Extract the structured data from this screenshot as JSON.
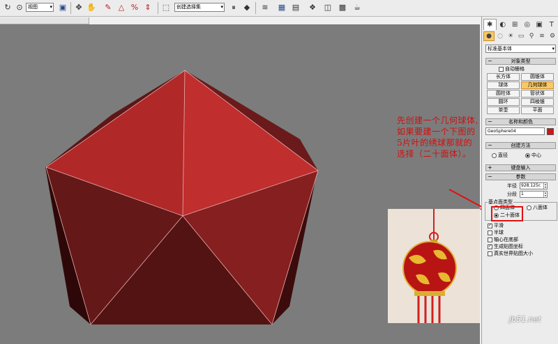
{
  "toolbar": {
    "view_select": "视图",
    "selection_set": "创建选择集"
  },
  "annotation": {
    "text": "先创建一个几何球体,如果要建一个下图的5片叶的绣球那就的选择（二十面体）。"
  },
  "command_panel": {
    "category_dropdown": "标准基本体",
    "object_type": {
      "header": "对象类型",
      "autogrid_label": "自动栅格",
      "buttons": [
        "长方体",
        "圆锥体",
        "球体",
        "几何球体",
        "圆柱体",
        "管状体",
        "圆环",
        "四棱锥",
        "茶壶",
        "平面"
      ],
      "active": "几何球体"
    },
    "name_color": {
      "header": "名称和颜色",
      "name_value": "GeoSphere04",
      "color": "#c81818"
    },
    "creation_method": {
      "header": "创建方法",
      "options": [
        "直径",
        "中心"
      ],
      "selected": "中心"
    },
    "keyboard_entry": {
      "header": "键盘输入"
    },
    "parameters": {
      "header": "参数",
      "radius_label": "半径",
      "radius_value": "928.125c",
      "segments_label": "分段",
      "segments_value": "1",
      "base_type_title": "基点面类型",
      "base_types": [
        "四面体",
        "八面体",
        "二十面体"
      ],
      "base_selected": "二十面体",
      "smooth_label": "平滑",
      "hemisphere_label": "半球",
      "base_pivot_label": "轴心在底部",
      "gen_mapping_label": "生成贴图坐标",
      "real_world_label": "真实世界贴图大小",
      "smooth_checked": true,
      "hemisphere_checked": false,
      "base_pivot_checked": false,
      "gen_mapping_checked": true,
      "real_world_checked": false
    }
  },
  "watermark": "jb51.net",
  "colors": {
    "viewport_bg": "#7c7c7c",
    "face_light": "#b42828",
    "face_dark": "#5a1414",
    "annotation_red": "#d01010"
  }
}
